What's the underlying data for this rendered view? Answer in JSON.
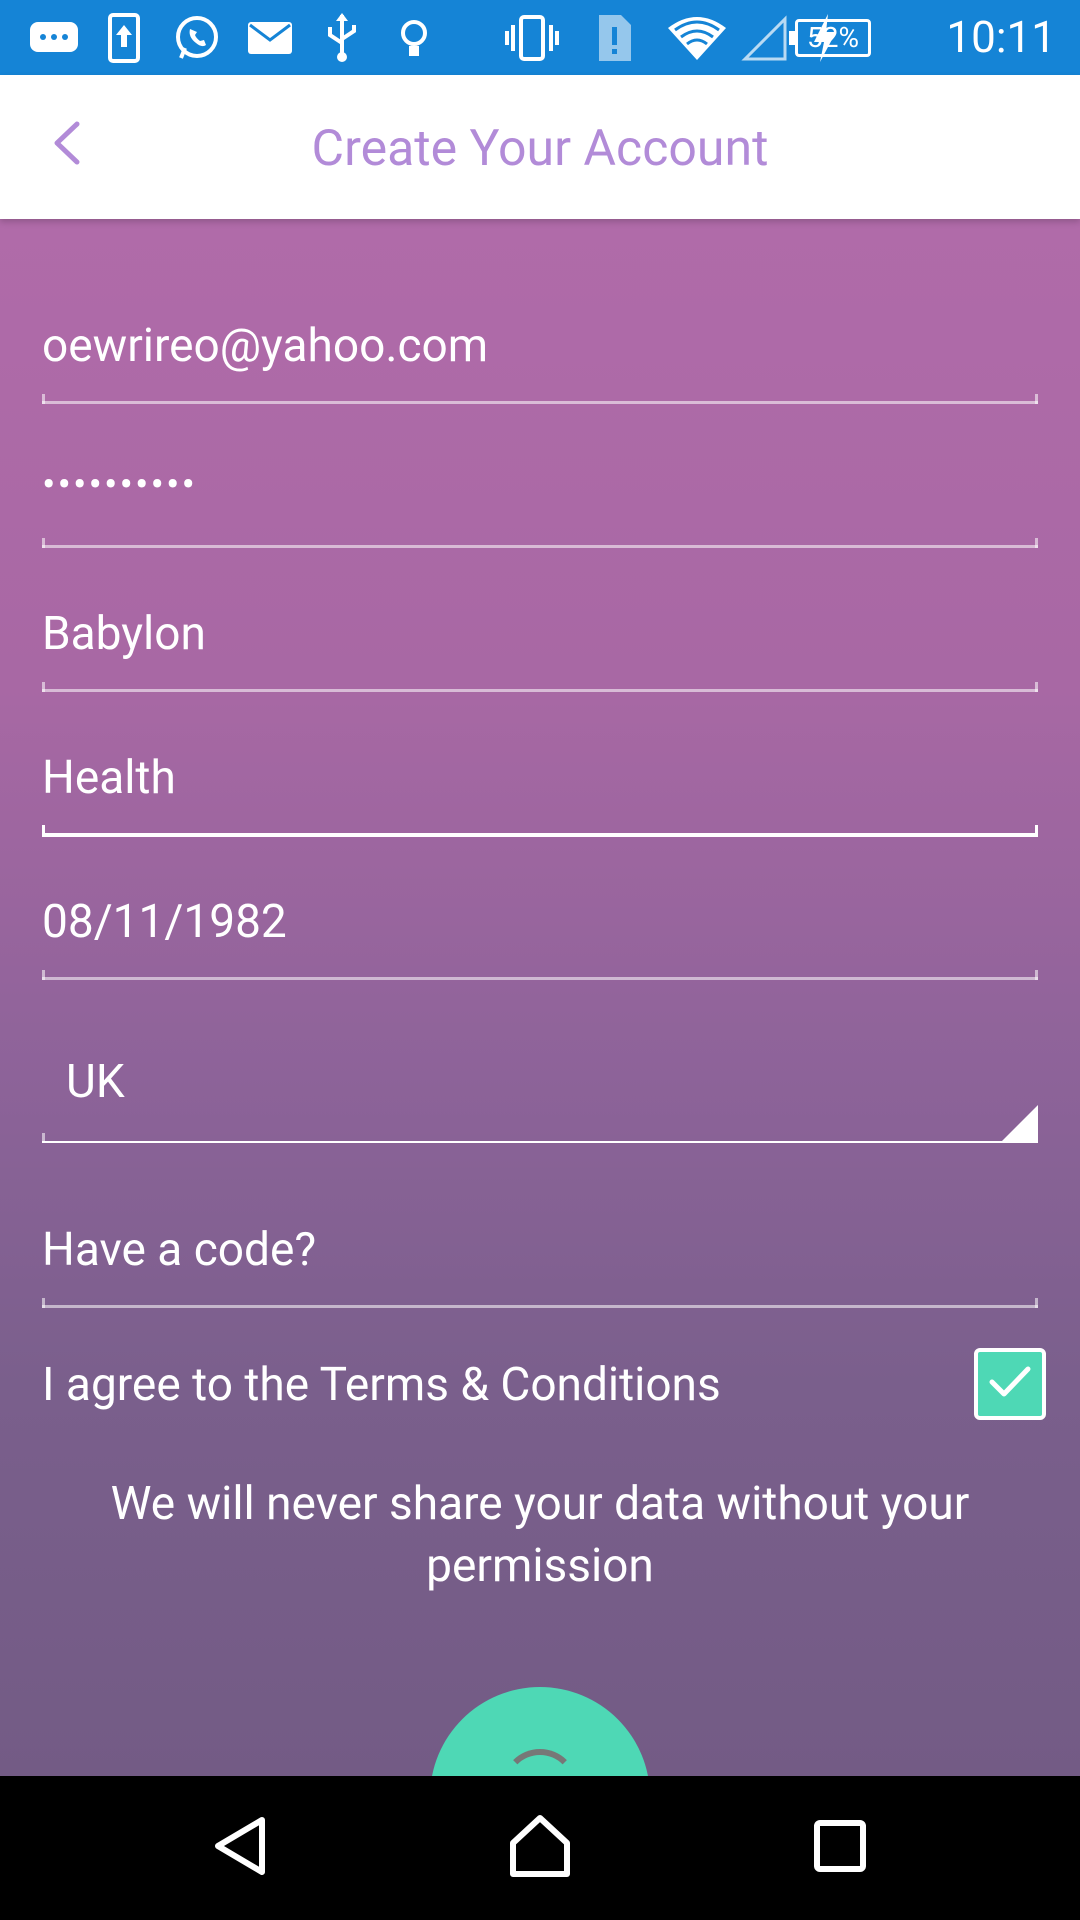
{
  "status_bar": {
    "time": "10:11",
    "battery": "52%",
    "icons": [
      "chat-bubble-icon",
      "upload-icon",
      "whatsapp-icon",
      "mail-icon",
      "usb-icon",
      "bulb-icon",
      "vibrate-icon",
      "sim-alert-icon",
      "wifi-icon",
      "signal-icon",
      "charging-icon"
    ]
  },
  "app_bar": {
    "title": "Create Your Account"
  },
  "form": {
    "email": "oewrireo@yahoo.com",
    "password": "••••••••••",
    "first_name": "Babylon",
    "last_name": "Health",
    "dob": "08/11/1982",
    "country": "UK",
    "code_placeholder": "Have a code?"
  },
  "terms": {
    "label": "I agree to the Terms & Conditions",
    "checked": true
  },
  "note": "We will never share your data without your permission",
  "colors": {
    "accent": "#4ed8b5",
    "status_bar": "#1584d6",
    "title": "#b28bd8",
    "gradient_top": "#b06ba9",
    "gradient_bottom": "#735b85"
  }
}
